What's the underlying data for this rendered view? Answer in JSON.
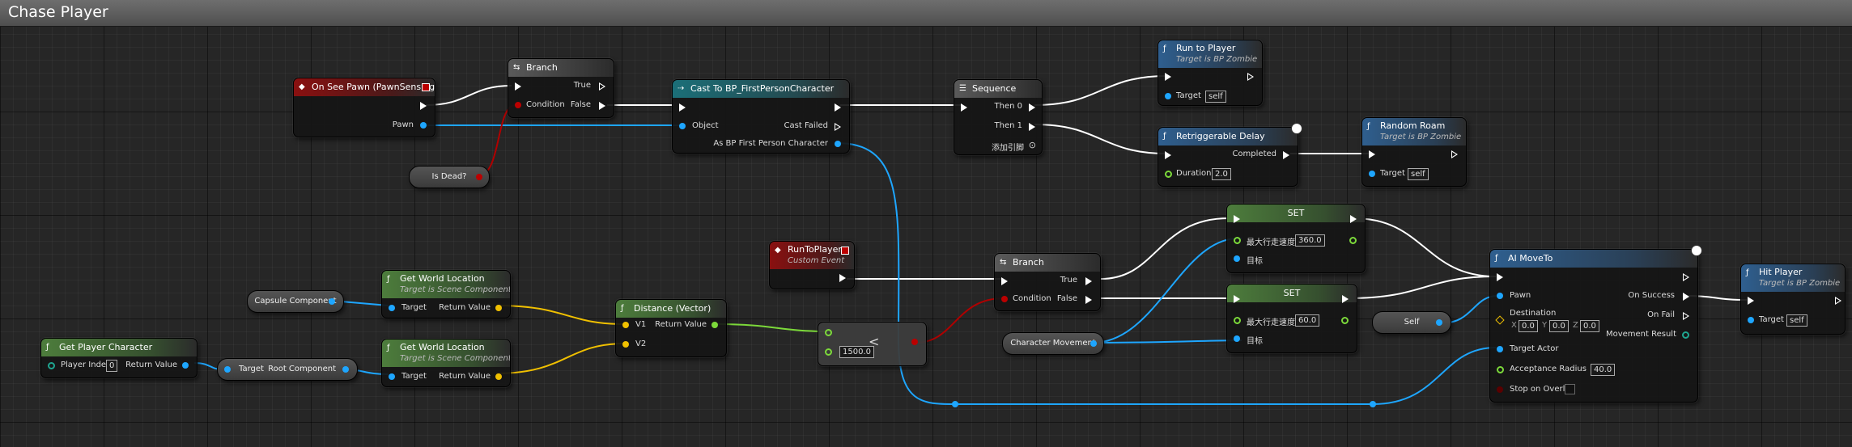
{
  "window": {
    "title": "Chase Player"
  },
  "nodes": {
    "on_see_pawn": {
      "title": "On See Pawn (PawnSensing)",
      "pin_pawn": "Pawn"
    },
    "branch1": {
      "title": "Branch",
      "pin_condition": "Condition",
      "pin_true": "True",
      "pin_false": "False"
    },
    "is_dead": {
      "label": "Is Dead?"
    },
    "cast": {
      "title": "Cast To BP_FirstPersonCharacter",
      "pin_object": "Object",
      "pin_cast_failed": "Cast Failed",
      "pin_as": "As BP First Person Character"
    },
    "sequence": {
      "title": "Sequence",
      "pin_then0": "Then 0",
      "pin_then1": "Then 1",
      "add_pin": "添加引脚"
    },
    "run_to_player_fn": {
      "title": "Run to Player",
      "subtitle": "Target is BP Zombie",
      "pin_target": "Target",
      "target_value": "self"
    },
    "retrig_delay": {
      "title": "Retriggerable Delay",
      "pin_duration": "Duration",
      "duration_value": "2.0",
      "pin_completed": "Completed"
    },
    "random_roam": {
      "title": "Random Roam",
      "subtitle": "Target is BP Zombie",
      "pin_target": "Target",
      "target_value": "self"
    },
    "run_to_player_evt": {
      "title": "RunToPlayer",
      "subtitle": "Custom Event"
    },
    "branch2": {
      "title": "Branch",
      "pin_condition": "Condition",
      "pin_true": "True",
      "pin_false": "False"
    },
    "set1": {
      "title": "SET",
      "pin_speed": "最大行走速度",
      "speed_value": "360.0",
      "pin_target": "目标"
    },
    "set2": {
      "title": "SET",
      "pin_speed": "最大行走速度",
      "speed_value": "60.0",
      "pin_target": "目标"
    },
    "char_movement": {
      "label": "Character Movement"
    },
    "self_pill": {
      "label": "Self"
    },
    "ai_move_to": {
      "title": "AI MoveTo",
      "pin_pawn": "Pawn",
      "pin_destination": "Destination",
      "x": "0.0",
      "y": "0.0",
      "z": "0.0",
      "x_label": "X",
      "y_label": "Y",
      "z_label": "Z",
      "pin_target_actor": "Target Actor",
      "pin_acceptance": "Acceptance Radius",
      "acceptance_value": "40.0",
      "pin_stop": "Stop on Overlap",
      "pin_on_success": "On Success",
      "pin_on_fail": "On Fail",
      "pin_movement_result": "Movement Result"
    },
    "hit_player": {
      "title": "Hit Player",
      "subtitle": "Target is BP Zombie",
      "pin_target": "Target",
      "target_value": "self"
    },
    "capsule": {
      "label": "Capsule Component"
    },
    "gwl1": {
      "title": "Get World Location",
      "subtitle": "Target is Scene Component",
      "pin_target": "Target",
      "pin_return": "Return Value"
    },
    "gwl2": {
      "title": "Get World Location",
      "subtitle": "Target is Scene Component",
      "pin_target": "Target",
      "pin_return": "Return Value"
    },
    "distance": {
      "title": "Distance (Vector)",
      "pin_v1": "V1",
      "pin_v2": "V2",
      "pin_return": "Return Value"
    },
    "less": {
      "op": "<",
      "value": "1500.0"
    },
    "get_player_char": {
      "title": "Get Player Character",
      "pin_index": "Player Index",
      "index_value": "0",
      "pin_return": "Return Value"
    },
    "root_comp": {
      "pin_target": "Target",
      "pin_root": "Root Component"
    }
  },
  "colors": {
    "exec": "#ffffff",
    "object": "#1ea6ff",
    "float": "#7cd93a",
    "bool": "#b00000",
    "vector": "#f0c000"
  }
}
